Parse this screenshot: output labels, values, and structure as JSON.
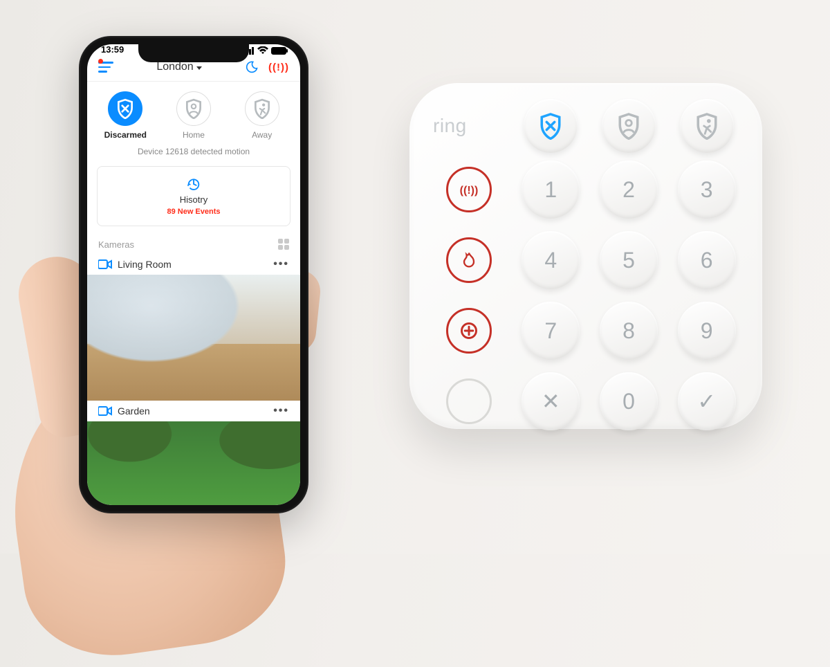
{
  "statusbar": {
    "time": "13:59"
  },
  "header": {
    "location": "London"
  },
  "modes": {
    "disarmed": "Discarmed",
    "home": "Home",
    "away": "Away",
    "motion_line": "Device 12618 detected motion"
  },
  "history": {
    "label": "Hisotry",
    "events": "89 New Events"
  },
  "section": {
    "cameras": "Kameras"
  },
  "cameras": [
    {
      "name": "Living Room"
    },
    {
      "name": "Garden"
    }
  ],
  "keypad": {
    "brand": "ring",
    "keys": [
      "1",
      "2",
      "3",
      "4",
      "5",
      "6",
      "7",
      "8",
      "9",
      "✕",
      "0",
      "✓"
    ]
  }
}
